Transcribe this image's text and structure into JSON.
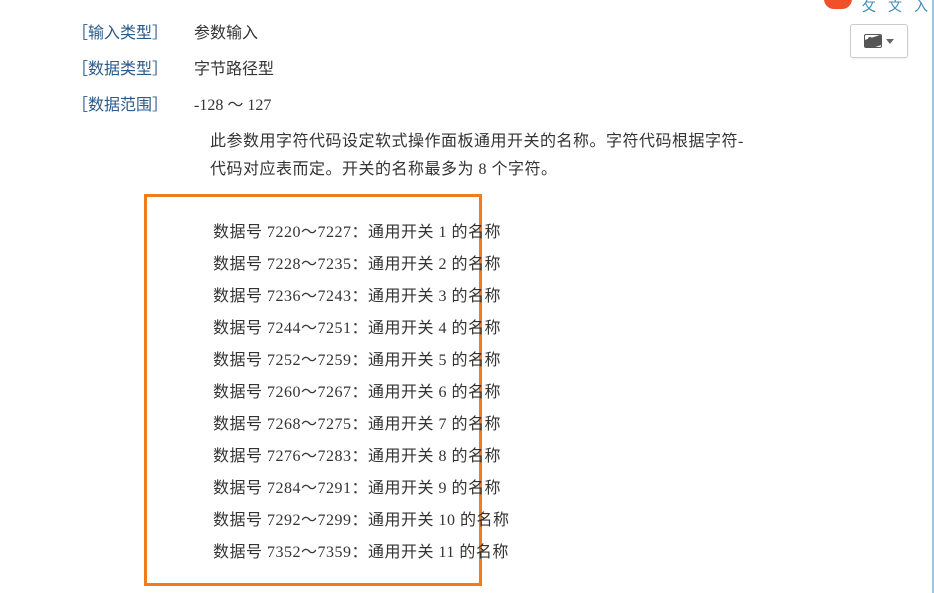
{
  "meta": {
    "input_type_label": "［输入类型］",
    "input_type_value": "参数输入",
    "data_type_label": "［数据类型］",
    "data_type_value": "字节路径型",
    "data_range_label": "［数据范围］",
    "data_range_value": "-128 ～ 127"
  },
  "description": {
    "line1": "此参数用字符代码设定软式操作面板通用开关的名称。字符代码根据字符-",
    "line2": "代码对应表而定。开关的名称最多为 8 个字符。"
  },
  "data_rows": [
    "数据号  7220～7227：通用开关 1 的名称",
    "数据号  7228～7235：通用开关 2 的名称",
    "数据号  7236～7243：通用开关 3 的名称",
    "数据号  7244～7251：通用开关 4 的名称",
    "数据号  7252～7259：通用开关 5 的名称",
    "数据号  7260～7267：通用开关 6 的名称",
    "数据号  7268～7275：通用开关 7 的名称",
    "数据号  7276～7283：通用开关 8 的名称",
    "数据号  7284～7291：通用开关 9 的名称",
    "数据号  7292～7299：通用开关 10 的名称",
    "数据号  7352～7359：通用开关 11 的名称"
  ],
  "topbar": {
    "c1": "攵",
    "c2": "文",
    "c3": "入"
  }
}
